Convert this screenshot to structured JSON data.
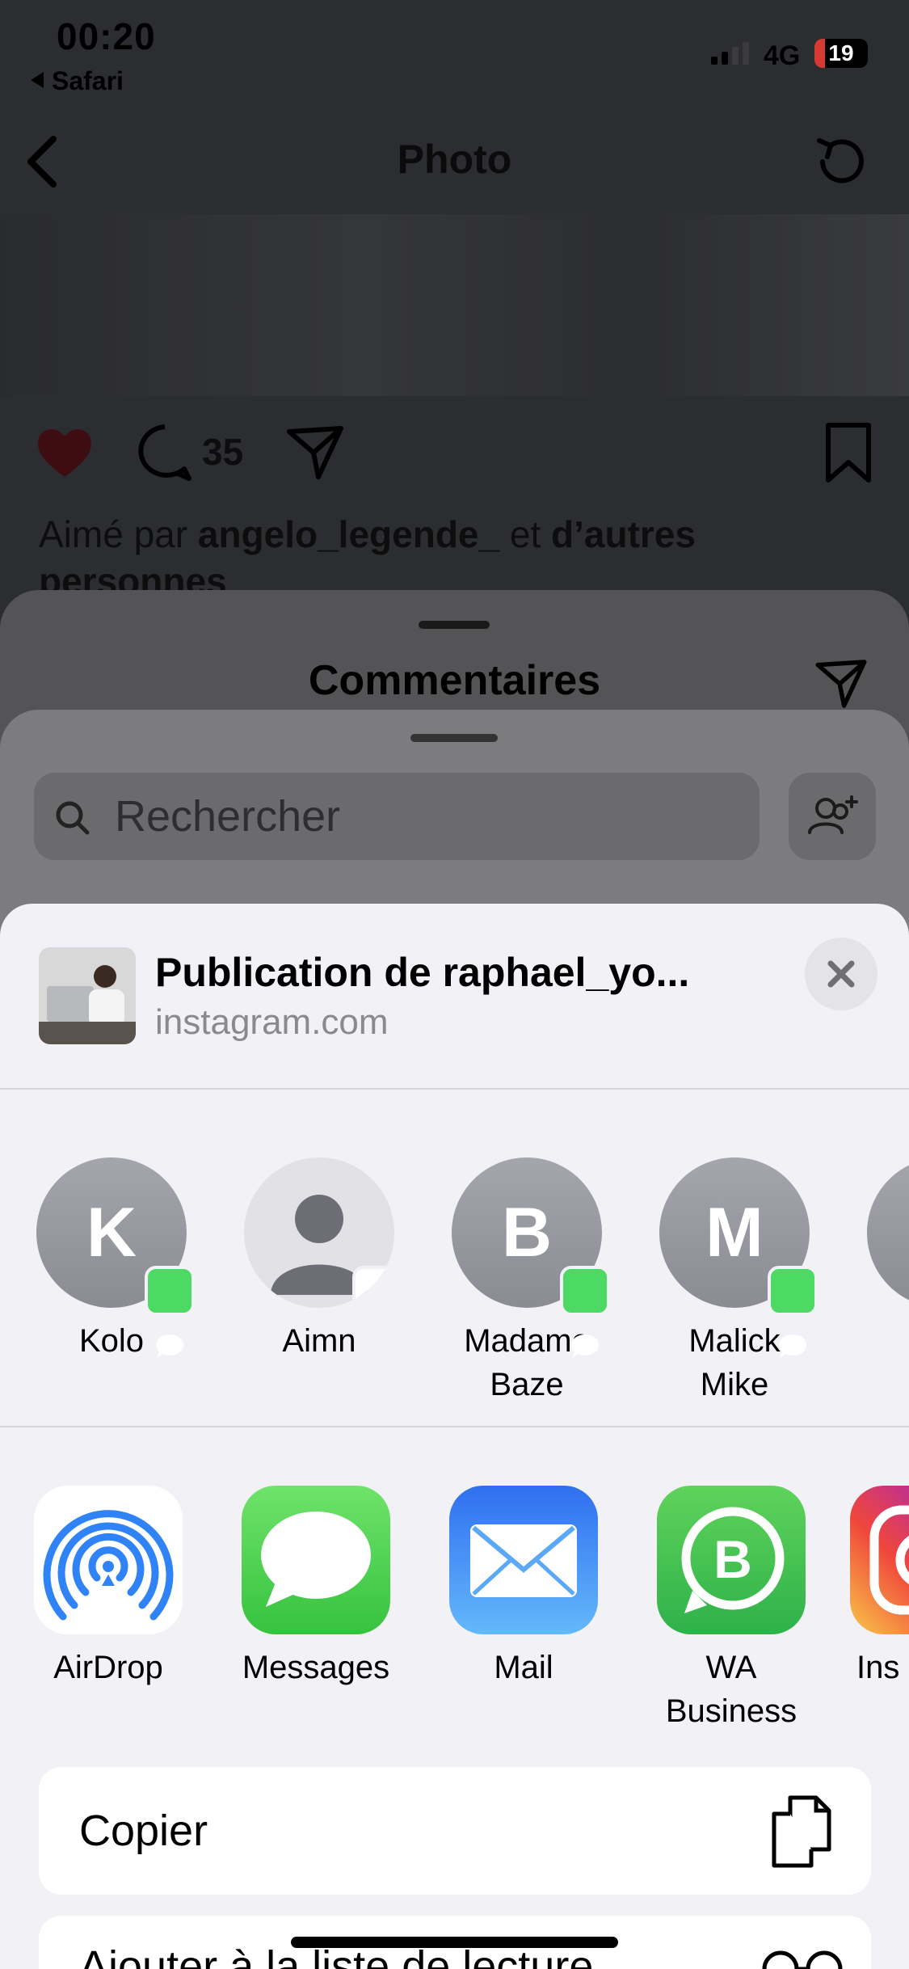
{
  "status_bar": {
    "time": "00:20",
    "back_app": "Safari",
    "network": "4G",
    "battery": "19",
    "battery_fraction": 0.19
  },
  "instagram": {
    "title": "Photo",
    "comment_count": "35",
    "liked_by_prefix": "Aimé par ",
    "liked_by_user": "angelo_legende_",
    "liked_by_mid": " et ",
    "liked_by_suffix": "d’autres personnes"
  },
  "comments_sheet": {
    "title": "Commentaires"
  },
  "send_sheet": {
    "search_placeholder": "Rechercher"
  },
  "share_sheet": {
    "title": "Publication de raphael_yo...",
    "subtitle": "instagram.com",
    "contacts": [
      {
        "initial": "K",
        "name": "Kolo",
        "badge": "messages"
      },
      {
        "initial": "",
        "name": "Aimn",
        "badge": "messenger"
      },
      {
        "initial": "B",
        "name": "Madame Baze",
        "badge": "messages"
      },
      {
        "initial": "M",
        "name": "Malick Mike",
        "badge": "messages"
      },
      {
        "initial": "",
        "name": "",
        "badge": ""
      }
    ],
    "apps": [
      {
        "name": "AirDrop",
        "icon": "airdrop-icon"
      },
      {
        "name": "Messages",
        "icon": "messages-icon"
      },
      {
        "name": "Mail",
        "icon": "mail-icon"
      },
      {
        "name": "WA Business",
        "icon": "whatsapp-business-icon"
      },
      {
        "name": "Ins",
        "icon": "instagram-icon"
      }
    ],
    "actions": [
      {
        "label": "Copier",
        "icon": "copy-icon"
      },
      {
        "label": "Ajouter à la liste de lecture",
        "icon": "glasses-icon"
      }
    ]
  },
  "colors": {
    "accent_blue": "#3478f6",
    "messages_green": "#4cd964",
    "heart_red": "#c31e32"
  }
}
